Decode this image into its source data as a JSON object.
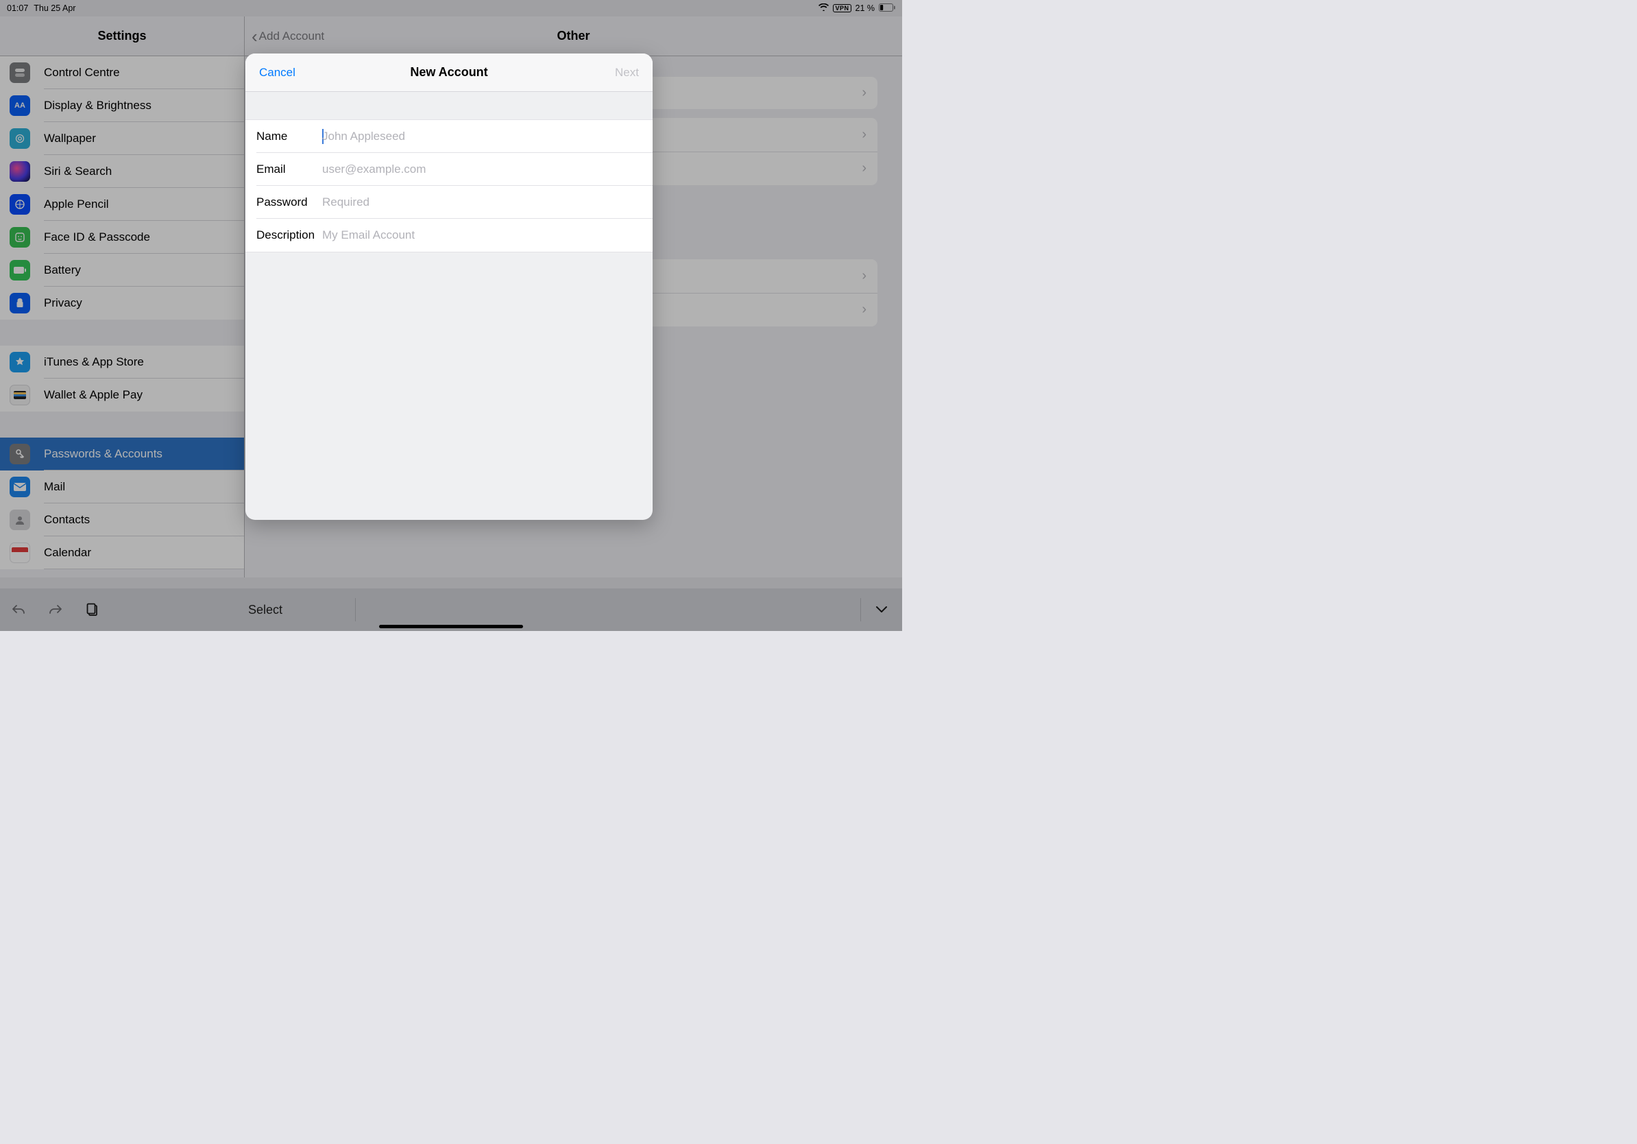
{
  "status": {
    "time": "01:07",
    "date": "Thu 25 Apr",
    "vpn": "VPN",
    "battery_pct": "21 %"
  },
  "sidebar": {
    "title": "Settings",
    "items": [
      {
        "key": "control",
        "label": "Control Centre"
      },
      {
        "key": "display",
        "label": "Display & Brightness"
      },
      {
        "key": "wallpaper",
        "label": "Wallpaper"
      },
      {
        "key": "siri",
        "label": "Siri & Search"
      },
      {
        "key": "pencil",
        "label": "Apple Pencil"
      },
      {
        "key": "face",
        "label": "Face ID & Passcode"
      },
      {
        "key": "battery",
        "label": "Battery"
      },
      {
        "key": "privacy",
        "label": "Privacy"
      }
    ],
    "group2": [
      {
        "key": "itunes",
        "label": "iTunes & App Store"
      },
      {
        "key": "wallet",
        "label": "Wallet & Apple Pay"
      }
    ],
    "group3": [
      {
        "key": "passwords",
        "label": "Passwords & Accounts",
        "selected": true
      },
      {
        "key": "mail",
        "label": "Mail"
      },
      {
        "key": "contacts",
        "label": "Contacts"
      },
      {
        "key": "calendar",
        "label": "Calendar"
      }
    ]
  },
  "content": {
    "back_label": "Add Account",
    "title": "Other"
  },
  "toolbar": {
    "select_label": "Select"
  },
  "modal": {
    "cancel_label": "Cancel",
    "next_label": "Next",
    "title": "New Account",
    "fields": {
      "name": {
        "label": "Name",
        "placeholder": "John Appleseed",
        "value": ""
      },
      "email": {
        "label": "Email",
        "placeholder": "user@example.com",
        "value": ""
      },
      "password": {
        "label": "Password",
        "placeholder": "Required",
        "value": ""
      },
      "description": {
        "label": "Description",
        "placeholder": "My Email Account",
        "value": ""
      }
    }
  }
}
